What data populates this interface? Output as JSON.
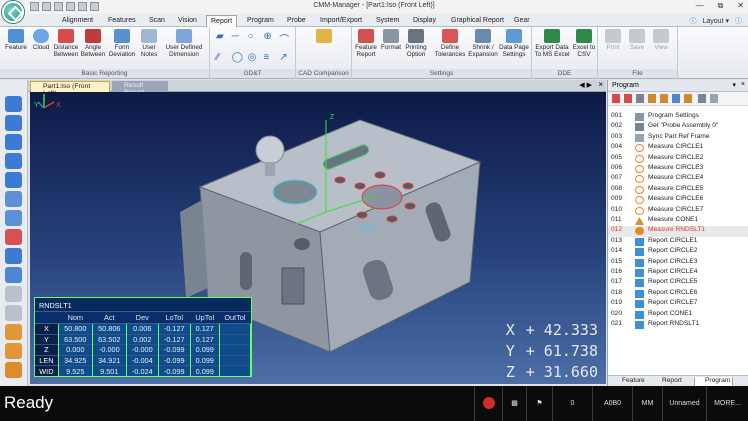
{
  "window": {
    "title": "CMM-Manager - [Part1:Iso (Front Left)]"
  },
  "menu_tabs": [
    "Alignment",
    "Features",
    "Scan",
    "Vision",
    "Report",
    "Program",
    "Probe",
    "Import/Export",
    "System",
    "Display",
    "Graphical Report",
    "Gear"
  ],
  "menu_active": "Report",
  "help": {
    "layout_label": "Layout"
  },
  "ribbon": {
    "groups": [
      {
        "label": "Basic Reporting",
        "buttons": [
          "Feature",
          "Cloud",
          "Distance Between",
          "Angle Between",
          "Form Deviation",
          "User Notes",
          "User Defined Dimension"
        ]
      },
      {
        "label": "GD&T",
        "buttons": []
      },
      {
        "label": "CAD Comparison",
        "buttons": []
      },
      {
        "label": "Settings",
        "buttons": [
          "Feature Report",
          "Format",
          "Printing Option",
          "Define Tolerances",
          "Shrink / Expansion",
          "Data Page Settings"
        ]
      },
      {
        "label": "DDE",
        "buttons": [
          "Export Data To MS Excel",
          "Excel to CSV"
        ]
      },
      {
        "label": "File",
        "buttons": [
          "Print",
          "Save",
          "View"
        ]
      }
    ]
  },
  "doc_tabs": {
    "active": "Part1:Iso (Front Left)",
    "inactive": "Result Report"
  },
  "viewport": {
    "feature_label": "CAD",
    "axes": {
      "x": "X",
      "y": "Y",
      "z": "Z"
    },
    "dro": [
      {
        "axis": "X",
        "value": "+ 42.333"
      },
      {
        "axis": "Y",
        "value": "+ 61.738"
      },
      {
        "axis": "Z",
        "value": "+ 31.660"
      }
    ]
  },
  "report_table": {
    "title": "RNDSLT1",
    "headers": [
      "",
      "Nom",
      "Act",
      "Dev",
      "LoTol",
      "UpTol",
      "OutTol"
    ],
    "rows": [
      [
        "X",
        "50.800",
        "50.806",
        "0.006",
        "-0.127",
        "0.127",
        ""
      ],
      [
        "Y",
        "63.500",
        "63.502",
        "0.002",
        "-0.127",
        "0.127",
        ""
      ],
      [
        "Z",
        "0.000",
        "-0.000",
        "-0.000",
        "-0.099",
        "0.099",
        ""
      ],
      [
        "LEN",
        "34.925",
        "34.921",
        "-0.004",
        "-0.099",
        "0.099",
        ""
      ],
      [
        "WID",
        "9.525",
        "9.501",
        "-0.024",
        "-0.099",
        "0.099",
        ""
      ]
    ]
  },
  "program_panel": {
    "title": "Program",
    "items": [
      {
        "num": "001",
        "label": "Program Settings",
        "icon": "settings-icon"
      },
      {
        "num": "002",
        "label": "Get \"Probe Assembly 0\"",
        "icon": "probe-icon"
      },
      {
        "num": "003",
        "label": "Sync Part Ref Frame",
        "icon": "sync-icon"
      },
      {
        "num": "004",
        "label": "Measure CIRCLE1",
        "icon": "circle-icon"
      },
      {
        "num": "005",
        "label": "Measure CIRCLE2",
        "icon": "circle-icon"
      },
      {
        "num": "006",
        "label": "Measure CIRCLE3",
        "icon": "circle-icon"
      },
      {
        "num": "007",
        "label": "Measure CIRCLE4",
        "icon": "circle-icon"
      },
      {
        "num": "008",
        "label": "Measure CIRCLE5",
        "icon": "circle-icon"
      },
      {
        "num": "009",
        "label": "Measure CIRCLE6",
        "icon": "circle-icon"
      },
      {
        "num": "010",
        "label": "Measure CIRCLE7",
        "icon": "circle-icon"
      },
      {
        "num": "011",
        "label": "Measure CONE1",
        "icon": "cone-icon"
      },
      {
        "num": "012",
        "label": "Measure RNDSLT1",
        "icon": "slot-icon"
      },
      {
        "num": "013",
        "label": "Report CIRCLE1",
        "icon": "report-icon"
      },
      {
        "num": "014",
        "label": "Report CIRCLE2",
        "icon": "report-icon"
      },
      {
        "num": "015",
        "label": "Report CIRCLE3",
        "icon": "report-icon"
      },
      {
        "num": "016",
        "label": "Report CIRCLE4",
        "icon": "report-icon"
      },
      {
        "num": "017",
        "label": "Report CIRCLE5",
        "icon": "report-icon"
      },
      {
        "num": "018",
        "label": "Report CIRCLE6",
        "icon": "report-icon"
      },
      {
        "num": "019",
        "label": "Report CIRCLE7",
        "icon": "report-icon"
      },
      {
        "num": "020",
        "label": "Report CONE1",
        "icon": "report-icon"
      },
      {
        "num": "021",
        "label": "Report RNDSLT1",
        "icon": "report-icon"
      }
    ],
    "selected": "012",
    "bottom_tabs": [
      "Feature",
      "Report",
      "Program"
    ],
    "bottom_active": "Program"
  },
  "status": {
    "ready": "Ready",
    "count": "0",
    "probe": "A0B0",
    "units": "MM",
    "name": "Unnamed",
    "more": "MORE..."
  }
}
